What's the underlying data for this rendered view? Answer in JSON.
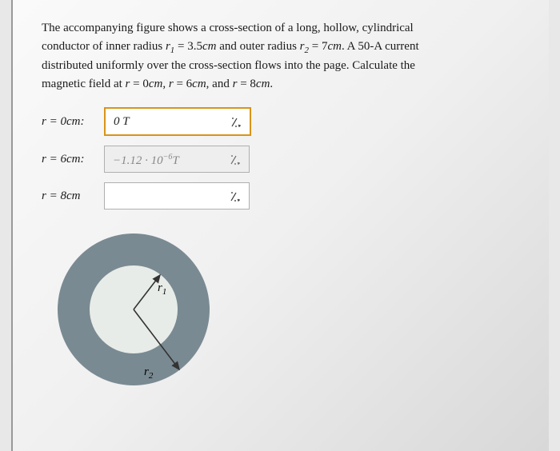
{
  "problem": {
    "line1_a": "The accompanying figure shows a cross-section of a long, hollow, cylindrical",
    "line2_a": "conductor of inner radius ",
    "r1_label": "r",
    "r1_sub": "1",
    "eq1": " = 3.5",
    "cm1": "cm",
    "and_outer": " and outer radius ",
    "r2_label": "r",
    "r2_sub": "2",
    "eq2": " = 7",
    "cm2": "cm",
    "tail2": ". A 50-A current",
    "line3": "distributed uniformly over the cross-section flows into the page. Calculate the",
    "line4_a": "magnetic field at ",
    "r_a": "r",
    "eq_a": " = 0",
    "cm_a": "cm",
    "comma1": ", ",
    "r_b": "r",
    "eq_b": " = 6",
    "cm_b": "cm",
    "and_text": ", and ",
    "r_c": "r",
    "eq_c": " = 8",
    "cm_c": "cm",
    "period": "."
  },
  "answers": {
    "row1_label_r": "r",
    "row1_label_eq": " = 0",
    "row1_label_cm": "cm",
    "row1_colon": ":",
    "row1_value": "0 T",
    "row2_label_r": "r",
    "row2_label_eq": " = 6",
    "row2_label_cm": "cm",
    "row2_colon": ":",
    "row2_value_num": "−1.12 · 10",
    "row2_value_exp": "−6",
    "row2_value_unit": "T",
    "row3_label_r": "r",
    "row3_label_eq": " = 8",
    "row3_label_cm": "cm"
  },
  "figure": {
    "r1_label": "r",
    "r1_sub": "1",
    "r2_label": "r",
    "r2_sub": "2"
  }
}
